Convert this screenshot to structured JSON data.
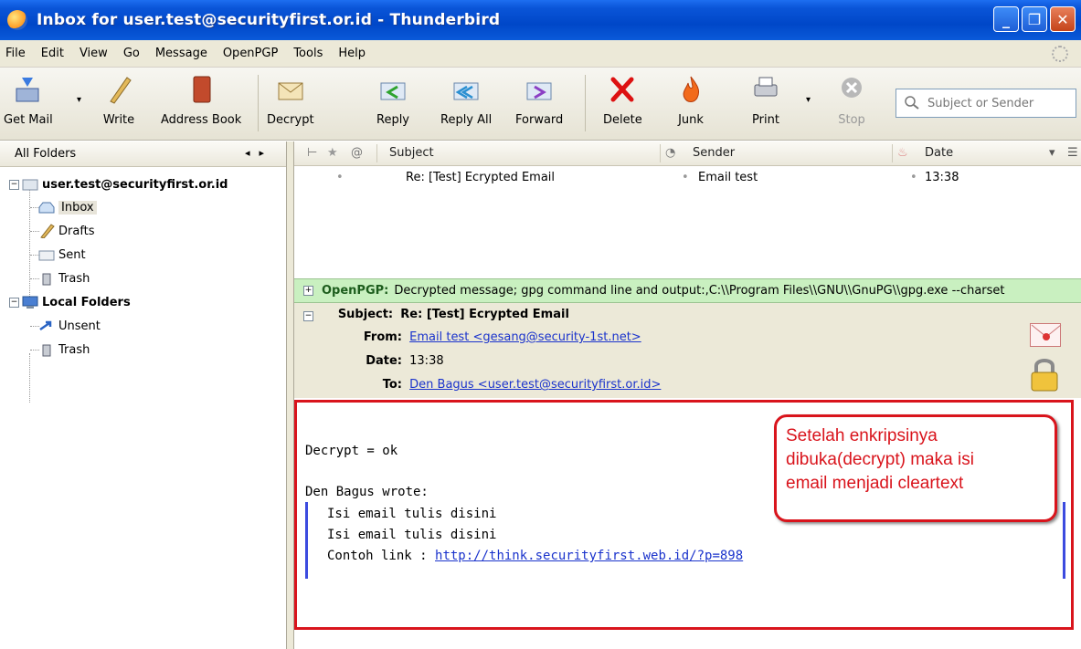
{
  "window": {
    "title": "Inbox for user.test@securityfirst.or.id - Thunderbird"
  },
  "menu": [
    "File",
    "Edit",
    "View",
    "Go",
    "Message",
    "OpenPGP",
    "Tools",
    "Help"
  ],
  "toolbar": {
    "get_mail": "Get Mail",
    "write": "Write",
    "address_book": "Address Book",
    "decrypt": "Decrypt",
    "reply": "Reply",
    "reply_all": "Reply All",
    "forward": "Forward",
    "delete": "Delete",
    "junk": "Junk",
    "print": "Print",
    "stop": "Stop",
    "search_placeholder": "Subject or Sender"
  },
  "folders": {
    "header": "All Folders",
    "account": "user.test@securityfirst.or.id",
    "inbox": "Inbox",
    "drafts": "Drafts",
    "sent": "Sent",
    "trash": "Trash",
    "local": "Local Folders",
    "unsent": "Unsent",
    "local_trash": "Trash"
  },
  "thread": {
    "col_subject": "Subject",
    "col_sender": "Sender",
    "col_date": "Date",
    "rows": [
      {
        "subject": "Re: [Test] Ecrypted Email",
        "sender": "Email test",
        "date": "13:38"
      }
    ]
  },
  "pgp": {
    "label": "OpenPGP:",
    "message": "Decrypted message; gpg command line and output:,C:\\\\Program Files\\\\GNU\\\\GnuPG\\\\gpg.exe --charset"
  },
  "header": {
    "subject_key": "Subject:",
    "subject": "Re: [Test] Ecrypted Email",
    "from_key": "From:",
    "from": "Email test <gesang@security-1st.net>",
    "date_key": "Date:",
    "date": "13:38",
    "to_key": "To:",
    "to": "Den Bagus <user.test@securityfirst.or.id>"
  },
  "body": {
    "line1": "Decrypt = ok",
    "wrote": "Den Bagus wrote:",
    "quote1": "Isi email tulis disini",
    "quote2": "Isi email tulis disini",
    "quote3_prefix": "Contoh link : ",
    "link": "http://think.securityfirst.web.id/?p=898"
  },
  "callout": {
    "line1": "Setelah enkripsinya",
    "line2": "dibuka(decrypt) maka isi",
    "line3": "email menjadi cleartext"
  }
}
